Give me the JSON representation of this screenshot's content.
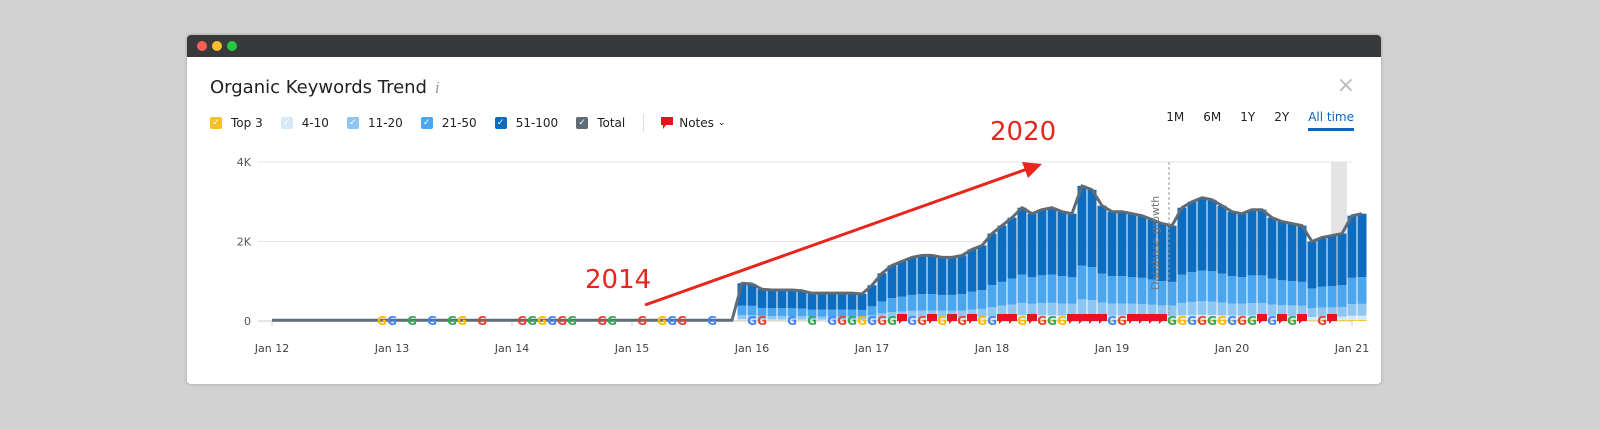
{
  "header": {
    "title": "Organic Keywords Trend",
    "info_icon": "i",
    "close_icon": "×"
  },
  "legend": [
    {
      "label": "Top 3",
      "color": "#f6c02c"
    },
    {
      "label": "4-10",
      "color": "#d5e9f9"
    },
    {
      "label": "11-20",
      "color": "#8ec5f1"
    },
    {
      "label": "21-50",
      "color": "#4aa7ef"
    },
    {
      "label": "51-100",
      "color": "#0b6cc0"
    },
    {
      "label": "Total",
      "color": "#5f6b75"
    }
  ],
  "notes_label": "Notes",
  "ranges": [
    {
      "label": "1M"
    },
    {
      "label": "6M"
    },
    {
      "label": "1Y"
    },
    {
      "label": "2Y"
    },
    {
      "label": "All time",
      "active": true
    }
  ],
  "annotations": {
    "start": "2014",
    "end": "2020",
    "event": "Database growth"
  },
  "chart_data": {
    "type": "bar",
    "title": "Organic Keywords Trend",
    "ylim": [
      0,
      4000
    ],
    "yticks": [
      {
        "v": 0,
        "label": "0"
      },
      {
        "v": 2000,
        "label": "2K"
      },
      {
        "v": 4000,
        "label": "4K"
      }
    ],
    "xticks": [
      "Jan 12",
      "Jan 13",
      "Jan 14",
      "Jan 15",
      "Jan 16",
      "Jan 17",
      "Jan 18",
      "Jan 19",
      "Jan 20",
      "Jan 21"
    ],
    "start_month": "Jan 2012",
    "baseline_before": 20,
    "bars_start_index": 47,
    "totals": [
      950,
      930,
      800,
      780,
      780,
      780,
      760,
      700,
      700,
      700,
      700,
      700,
      680,
      900,
      1200,
      1400,
      1500,
      1600,
      1650,
      1650,
      1600,
      1600,
      1650,
      1800,
      1900,
      2200,
      2400,
      2600,
      2850,
      2700,
      2800,
      2850,
      2750,
      2700,
      3400,
      3300,
      2900,
      2750,
      2750,
      2700,
      2650,
      2550,
      2450,
      2400,
      2850,
      3000,
      3100,
      3050,
      2900,
      2750,
      2700,
      2800,
      2800,
      2600,
      2500,
      2450,
      2400,
      2000,
      2100,
      2150,
      2200,
      2650,
      2700
    ],
    "series_share": {
      "Top 3": 0.01,
      "4-10": 0.04,
      "11-20": 0.11,
      "21-50": 0.25,
      "51-100": 0.59
    },
    "google_updates": [
      11,
      12,
      14,
      16,
      18,
      19,
      21,
      25,
      26,
      27,
      28,
      29,
      30,
      33,
      34,
      37,
      39,
      40,
      41,
      44,
      48,
      49,
      52,
      54,
      56,
      57,
      58,
      59,
      60,
      61,
      62,
      64,
      65,
      67,
      69,
      71,
      72,
      75,
      77,
      78,
      79,
      84,
      85,
      90,
      91,
      92,
      93,
      94,
      95,
      96,
      97,
      98,
      100,
      102,
      105
    ],
    "notes": [
      63,
      66,
      68,
      70,
      73,
      74,
      76,
      80,
      81,
      82,
      83,
      86,
      87,
      88,
      89,
      99,
      101,
      103,
      106
    ],
    "event_index": 89.7
  }
}
